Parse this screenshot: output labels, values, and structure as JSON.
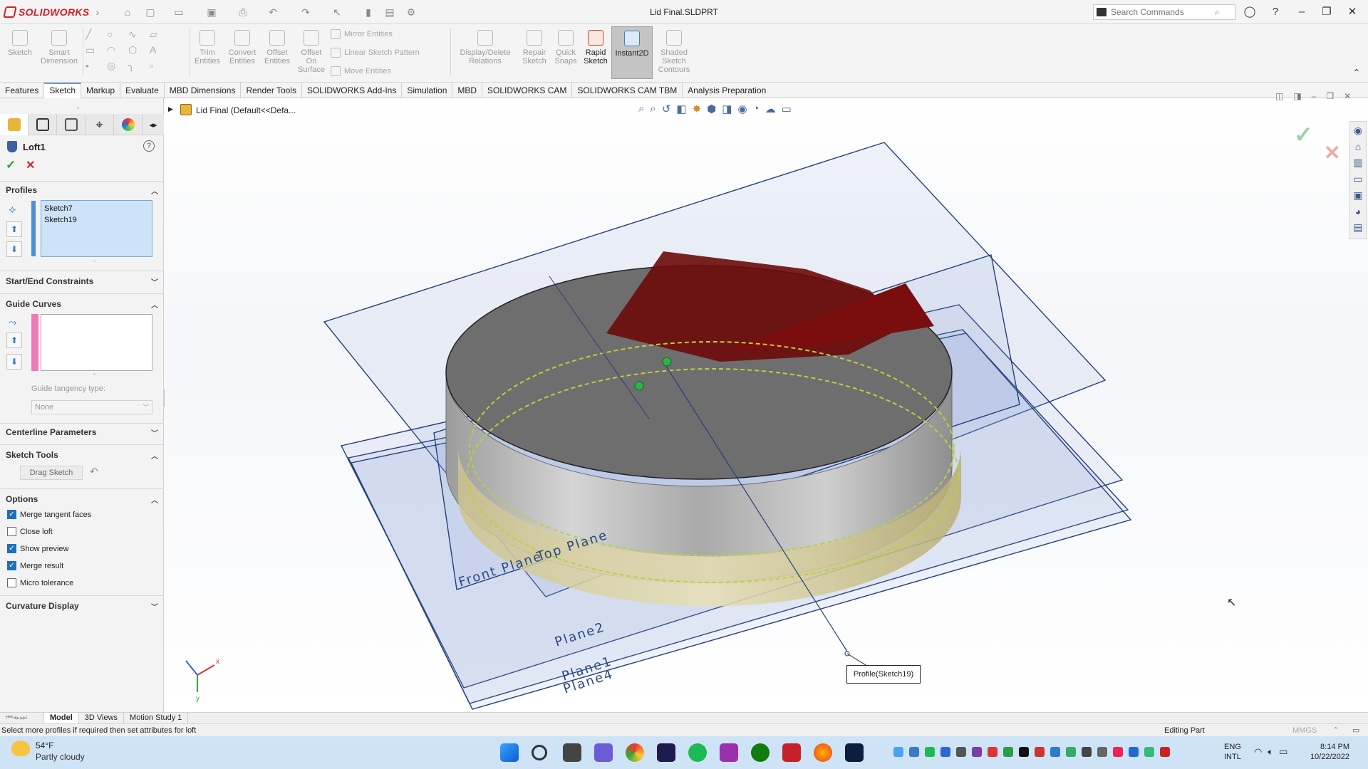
{
  "app": {
    "name": "SOLIDWORKS",
    "document_title": "Lid Final.SLDPRT"
  },
  "search": {
    "placeholder": "Search Commands"
  },
  "ribbon": {
    "sketch": "Sketch",
    "smart_dimension": "Smart Dimension",
    "trim_entities": "Trim Entities",
    "convert_entities": "Convert Entities",
    "offset_entities": "Offset Entities",
    "offset_on_surface": "Offset On Surface",
    "mirror_entities": "Mirror Entities",
    "linear_sketch_pattern": "Linear Sketch Pattern",
    "move_entities": "Move Entities",
    "display_delete_relations": "Display/Delete Relations",
    "repair_sketch": "Repair Sketch",
    "quick_snaps": "Quick Snaps",
    "rapid_sketch": "Rapid Sketch",
    "instant2d": "Instant2D",
    "shaded_sketch_contours": "Shaded Sketch Contours"
  },
  "tabs": [
    "Features",
    "Sketch",
    "Markup",
    "Evaluate",
    "MBD Dimensions",
    "Render Tools",
    "SOLIDWORKS Add-Ins",
    "Simulation",
    "MBD",
    "SOLIDWORKS CAM",
    "SOLIDWORKS CAM TBM",
    "Analysis Preparation"
  ],
  "active_tab": "Sketch",
  "tree_path": "Lid Final  (Default<<Defa...",
  "property_manager": {
    "title": "Loft1",
    "profiles": {
      "header": "Profiles",
      "items": [
        "Sketch7",
        "Sketch19"
      ]
    },
    "start_end": "Start/End Constraints",
    "guide_curves": {
      "header": "Guide Curves",
      "tangency_label": "Guide tangency type:",
      "tangency_value": "None"
    },
    "centerline": "Centerline Parameters",
    "sketch_tools": {
      "header": "Sketch Tools",
      "drag_sketch": "Drag Sketch"
    },
    "options": {
      "header": "Options",
      "items": [
        {
          "label": "Merge tangent faces",
          "checked": true
        },
        {
          "label": "Close loft",
          "checked": false
        },
        {
          "label": "Show preview",
          "checked": true
        },
        {
          "label": "Merge result",
          "checked": true
        },
        {
          "label": "Micro tolerance",
          "checked": false
        }
      ]
    },
    "curvature_display": "Curvature Display"
  },
  "viewport": {
    "plane_labels": [
      "Top Plane",
      "Front Plane",
      "Plane2",
      "Plane1",
      "Plane4"
    ],
    "callout": "Profile(Sketch19)",
    "triad": {
      "x": "x",
      "y": "y"
    }
  },
  "bottom_tabs": [
    "Model",
    "3D Views",
    "Motion Study 1"
  ],
  "status": {
    "message": "Select more profiles if required then set attributes for loft",
    "mode": "Editing Part",
    "units": "MMGS"
  },
  "taskbar": {
    "weather_temp": "54°F",
    "weather_desc": "Partly cloudy",
    "lang1": "ENG",
    "lang2": "INTL",
    "time": "8:14 PM",
    "date": "10/22/2022"
  }
}
